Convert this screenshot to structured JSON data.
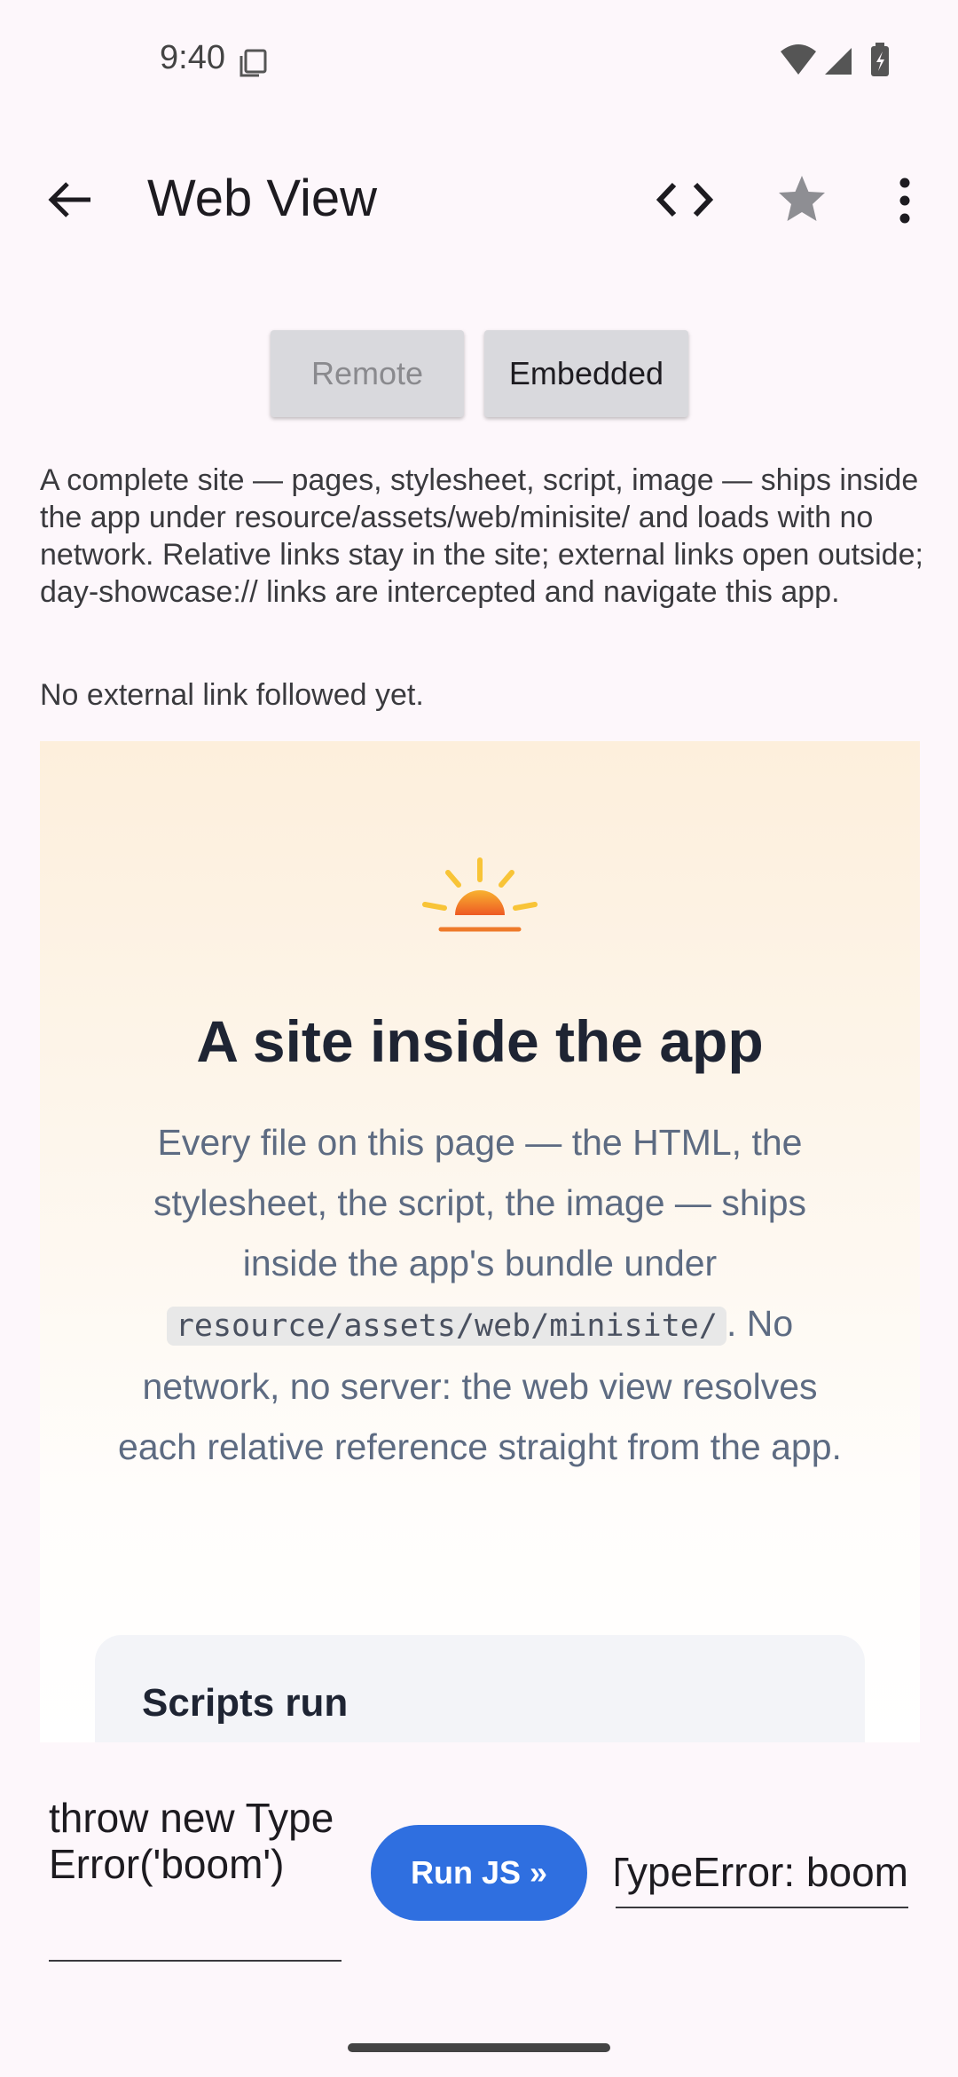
{
  "status_bar": {
    "time": "9:40"
  },
  "app_bar": {
    "title": "Web View"
  },
  "segments": {
    "remote": "Remote",
    "embedded": "Embedded",
    "selected": "Embedded"
  },
  "description": "A complete site — pages, stylesheet, script, image — ships inside the app under resource/assets/web/minisite/ and loads with no network. Relative links stay in the site; external links open outside; day-showcase:// links are intercepted and navigate this app.",
  "link_status": "No external link followed yet.",
  "web": {
    "title": "A site inside the app",
    "para_before": "Every file on this page — the HTML, the stylesheet, the script, the image — ships inside the app's bundle under ",
    "code": "resource/assets/web/minisite/",
    "para_after": ". No network, no server: the web view resolves each relative reference straight from the app.",
    "card_title": "Scripts run"
  },
  "controls": {
    "js_input": "throw new TypeError('boom')",
    "run_label": "Run JS »",
    "result": "TypeError: boom"
  },
  "colors": {
    "accent": "#2f6fe0",
    "background": "#fdf7fb"
  }
}
